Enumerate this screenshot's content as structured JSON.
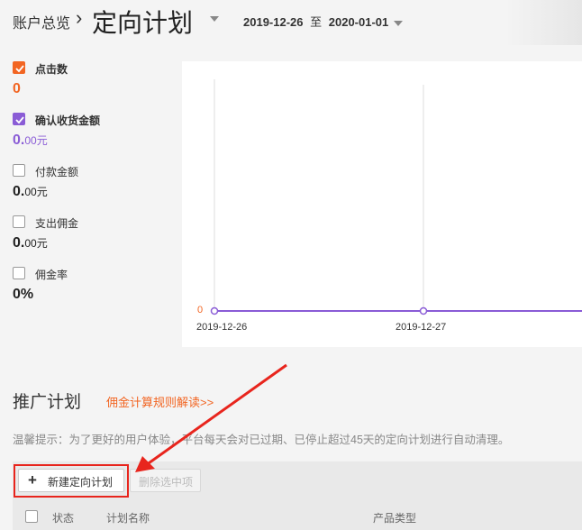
{
  "header": {
    "breadcrumb": "账户总览",
    "separator": "›",
    "title": "定向计划",
    "date_start": "2019-12-26",
    "date_sep": "至",
    "date_end": "2020-01-01"
  },
  "metrics": [
    {
      "label": "点击数",
      "value": "0",
      "unit": "",
      "checked": true,
      "color": "#f26522"
    },
    {
      "label": "确认收货金额",
      "value": "0.",
      "unit": "00元",
      "checked": true,
      "color": "#8a5cd6"
    },
    {
      "label": "付款金额",
      "value": "0.",
      "unit": "00元",
      "checked": false
    },
    {
      "label": "支出佣金",
      "value": "0.",
      "unit": "00元",
      "checked": false
    },
    {
      "label": "佣金率",
      "value": "0%",
      "unit": "",
      "checked": false
    }
  ],
  "chart": {
    "y_tick": "0",
    "x_ticks": [
      "2019-12-26",
      "2019-12-27"
    ],
    "series_color": "#8a5cd6",
    "axis_label_color": "#f26522"
  },
  "promotion": {
    "title": "推广计划",
    "rule_link": "佣金计算规则解读>>",
    "tip": "温馨提示：为了更好的用户体验，平台每天会对已过期、已停止超过45天的定向计划进行自动清理。",
    "new_button": "新建定向计划",
    "delete_button": "删除选中项",
    "columns": [
      "状态",
      "计划名称",
      "产品类型"
    ]
  }
}
